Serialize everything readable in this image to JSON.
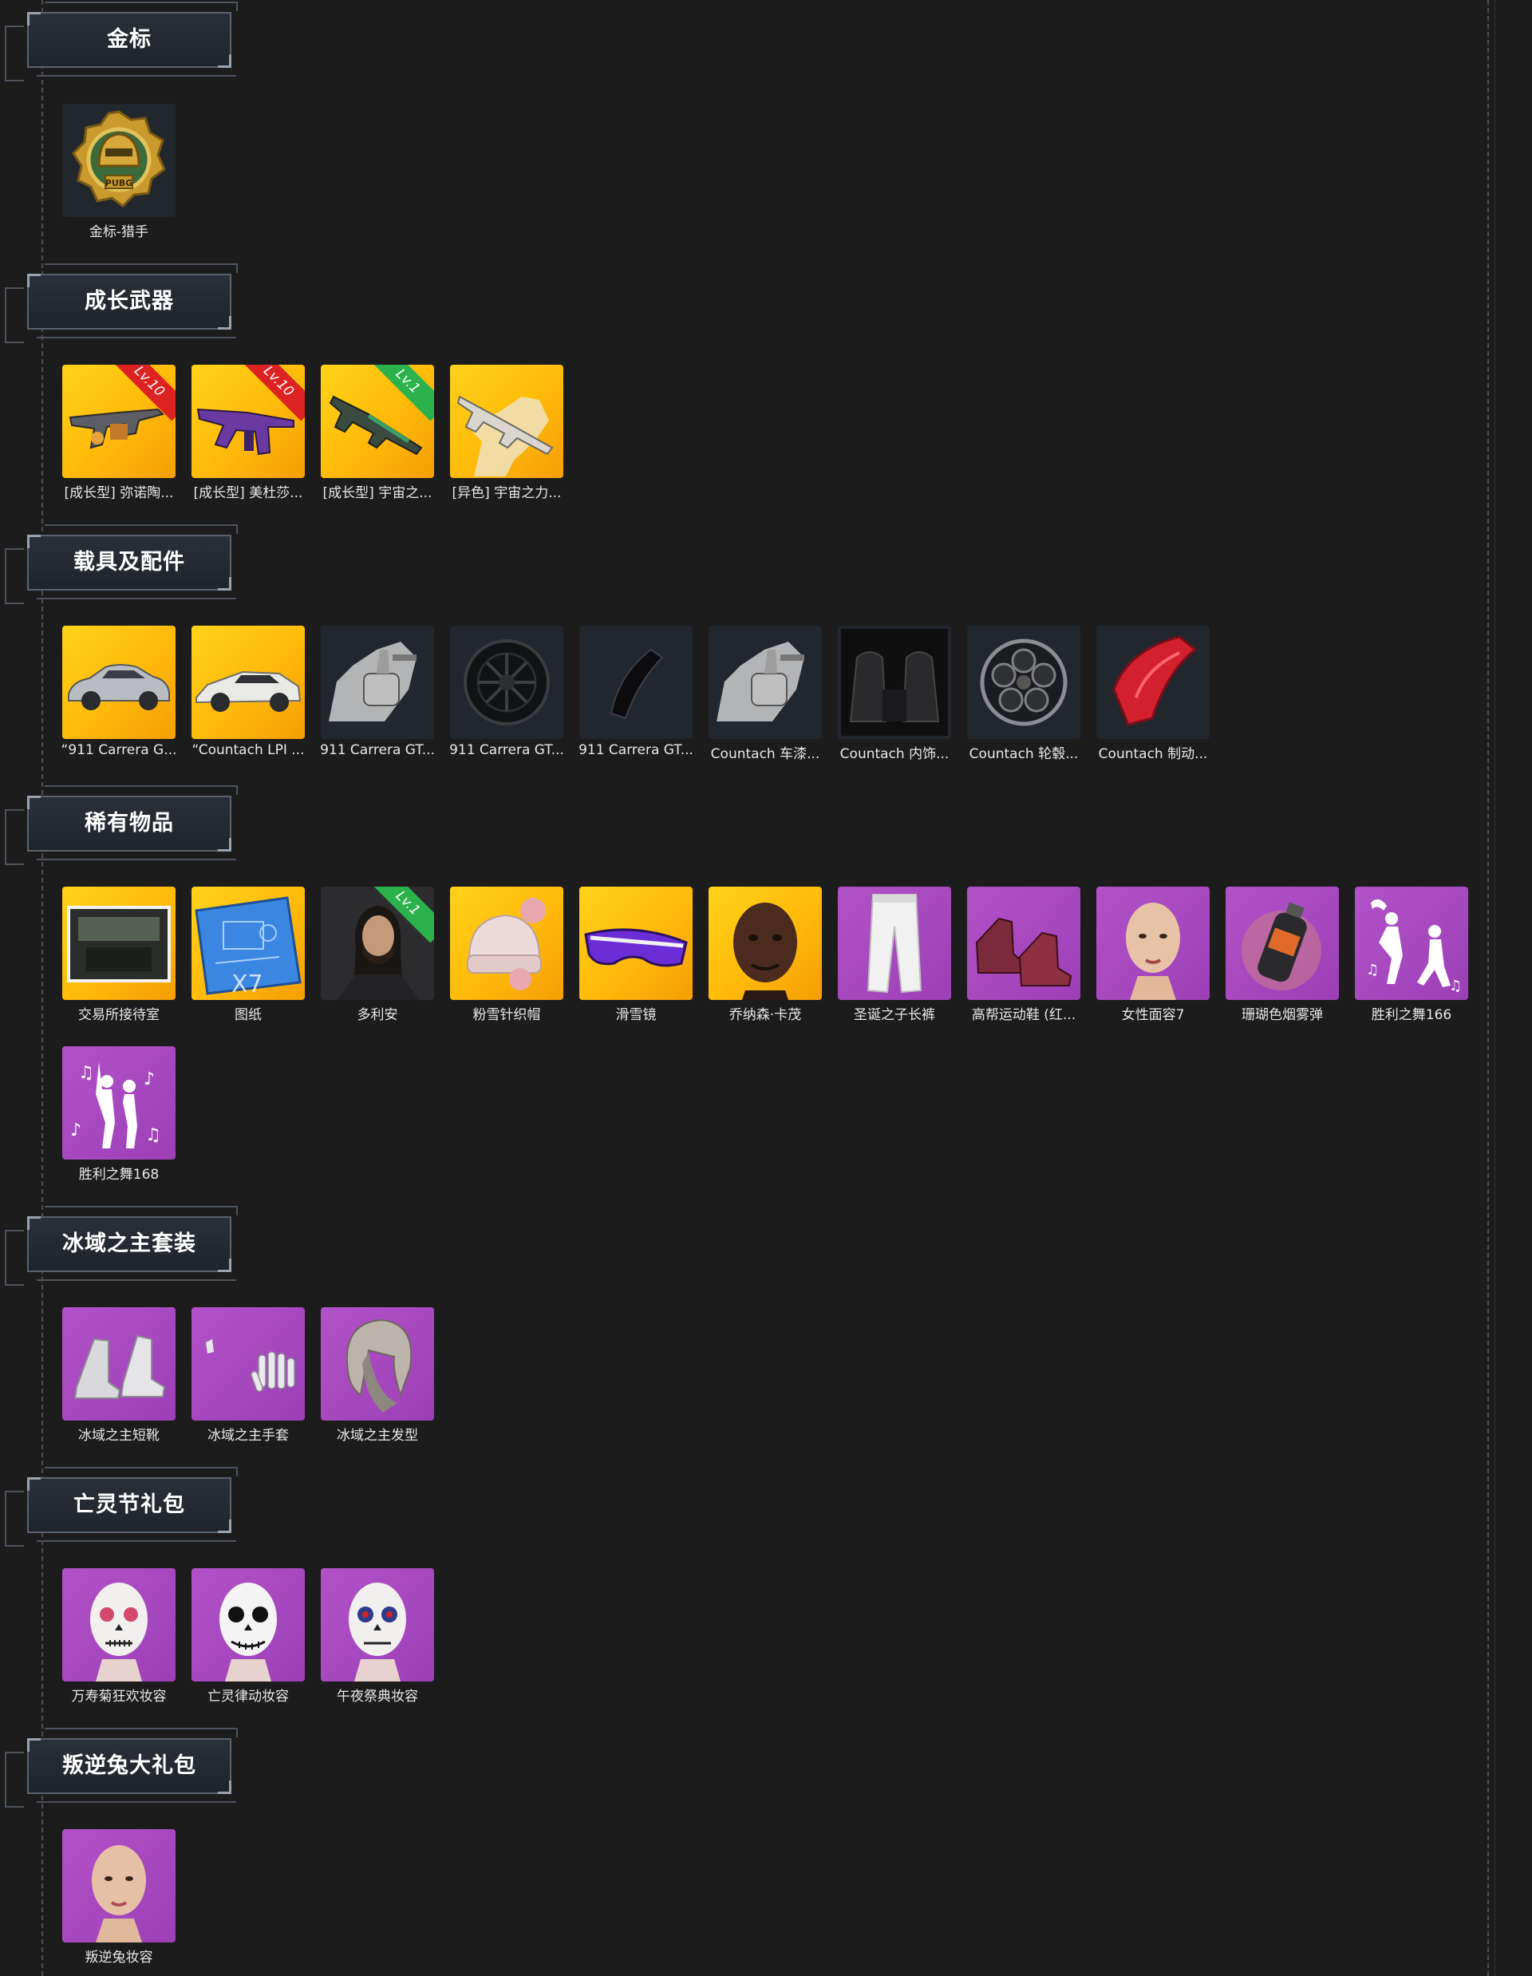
{
  "sections": {
    "s0": {
      "title": "金标"
    },
    "s1": {
      "title": "成长武器"
    },
    "s2": {
      "title": "载具及配件"
    },
    "s3": {
      "title": "稀有物品"
    },
    "s4": {
      "title": "冰域之主套装"
    },
    "s5": {
      "title": "亡灵节礼包"
    },
    "s6": {
      "title": "叛逆兔大礼包"
    }
  },
  "items": {
    "gold_hunter": {
      "label": "金标-猎手",
      "icon": "gold-medal-icon"
    },
    "w1": {
      "label": "[成长型] 弥诺陶...",
      "badge": "Lv.10",
      "badge_color": "#dd2222",
      "icon": "rifle-icon"
    },
    "w2": {
      "label": "[成长型] 美杜莎...",
      "badge": "Lv.10",
      "badge_color": "#dd2222",
      "icon": "rifle-icon"
    },
    "w3": {
      "label": "[成长型] 宇宙之...",
      "badge": "Lv.1",
      "badge_color": "#2bb24c",
      "icon": "rifle-icon"
    },
    "w4": {
      "label": "[异色] 宇宙之力...",
      "icon": "rifle-icon"
    },
    "v1": {
      "label": "“911 Carrera G...",
      "icon": "car-icon"
    },
    "v2": {
      "label": "“Countach LPI ...",
      "icon": "car-icon"
    },
    "v3": {
      "label": "911 Carrera GT...",
      "icon": "spray-gun-icon"
    },
    "v4": {
      "label": "911 Carrera GT...",
      "icon": "wheel-icon"
    },
    "v5": {
      "label": "911 Carrera GT...",
      "icon": "brake-caliper-icon"
    },
    "v6": {
      "label": "Countach 车漆...",
      "icon": "spray-gun-icon"
    },
    "v7": {
      "label": "Countach 内饰...",
      "icon": "car-seat-icon"
    },
    "v8": {
      "label": "Countach 轮毂...",
      "icon": "wheel-icon"
    },
    "v9": {
      "label": "Countach 制动...",
      "icon": "brake-caliper-icon"
    },
    "r1": {
      "label": "交易所接待室",
      "icon": "room-icon"
    },
    "r2": {
      "label": "图纸",
      "qty": "X7",
      "icon": "blueprint-icon"
    },
    "r3": {
      "label": "多利安",
      "badge": "Lv.1",
      "badge_color": "#2bb24c",
      "icon": "character-icon"
    },
    "r4": {
      "label": "粉雪针织帽",
      "icon": "beanie-icon"
    },
    "r5": {
      "label": "滑雪镜",
      "icon": "goggles-icon"
    },
    "r6": {
      "label": "乔纳森·卡茂",
      "icon": "face-icon"
    },
    "r7": {
      "label": "圣诞之子长裤",
      "icon": "pants-icon"
    },
    "r8": {
      "label": "高帮运动鞋 (红...",
      "icon": "sneakers-icon"
    },
    "r9": {
      "label": "女性面容7",
      "icon": "face-icon"
    },
    "r10": {
      "label": "珊瑚色烟雾弹",
      "icon": "smoke-grenade-icon"
    },
    "r11": {
      "label": "胜利之舞166",
      "icon": "dance-emote-icon"
    },
    "r12": {
      "label": "胜利之舞168",
      "icon": "dance-emote-icon"
    },
    "i1": {
      "label": "冰域之主短靴",
      "icon": "boots-icon"
    },
    "i2": {
      "label": "冰域之主手套",
      "icon": "gloves-icon"
    },
    "i3": {
      "label": "冰域之主发型",
      "icon": "hairstyle-icon"
    },
    "d1": {
      "label": "万寿菊狂欢妆容",
      "icon": "skull-makeup-icon"
    },
    "d2": {
      "label": "亡灵律动妆容",
      "icon": "skull-makeup-icon"
    },
    "d3": {
      "label": "午夜祭典妆容",
      "icon": "skull-makeup-icon"
    },
    "b1": {
      "label": "叛逆兔妆容",
      "icon": "face-icon"
    }
  }
}
